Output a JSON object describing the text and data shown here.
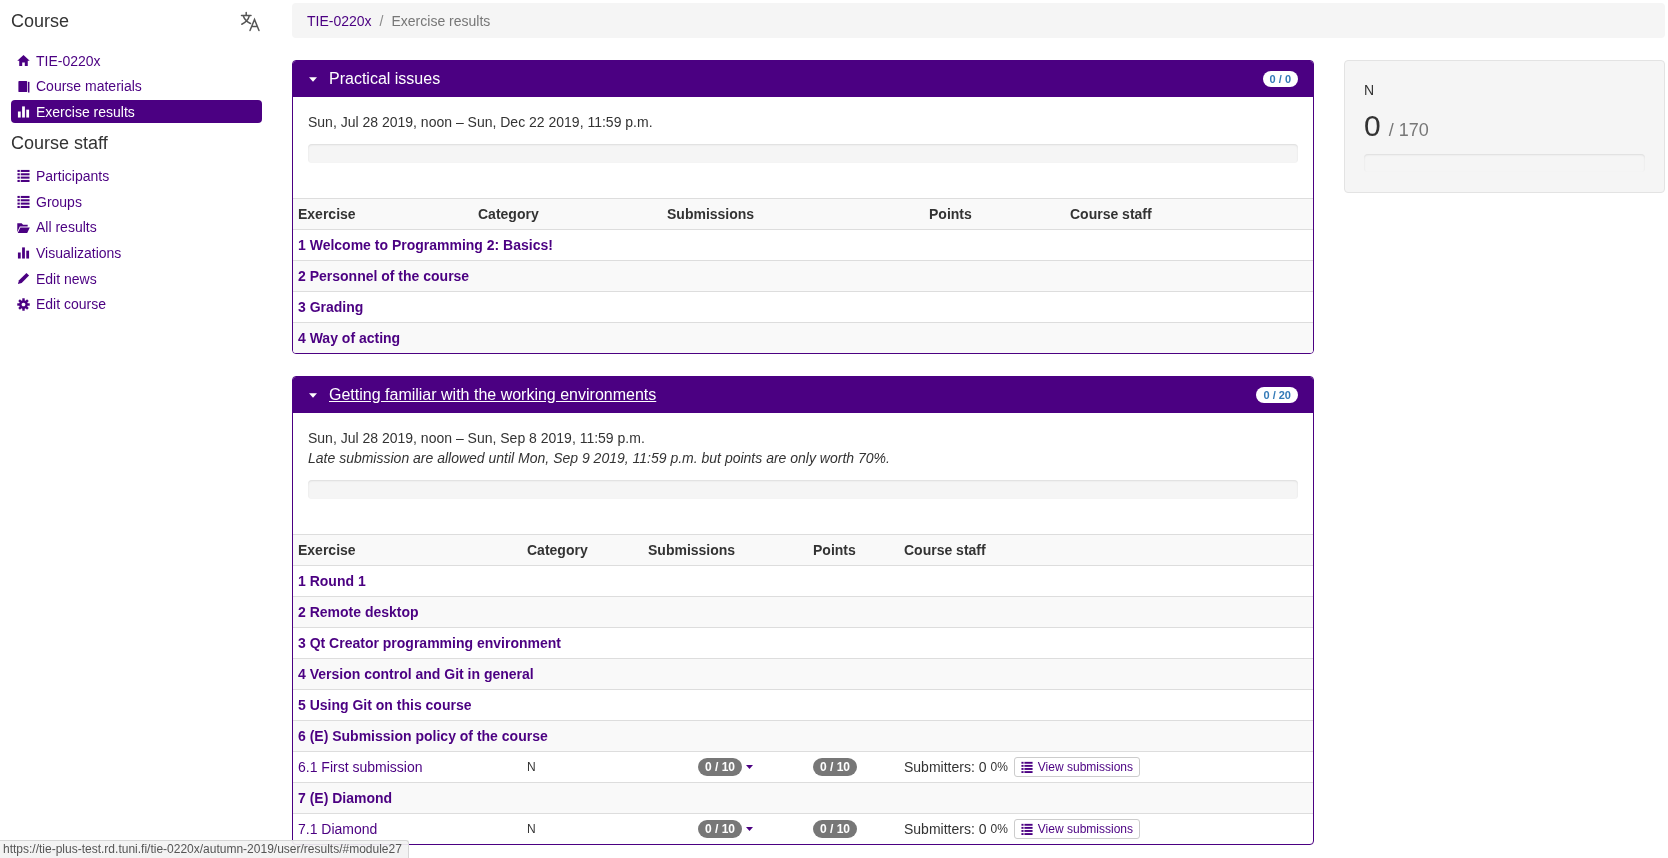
{
  "sidebar": {
    "sections": [
      {
        "title": "Course",
        "items": [
          {
            "kind": "home",
            "label": "TIE-0220x",
            "selected": false
          },
          {
            "kind": "book",
            "label": "Course materials",
            "selected": false
          },
          {
            "kind": "bar-chart",
            "label": "Exercise results",
            "selected": true
          }
        ]
      },
      {
        "title": "Course staff",
        "items": [
          {
            "kind": "list",
            "label": "Participants",
            "selected": false
          },
          {
            "kind": "list",
            "label": "Groups",
            "selected": false
          },
          {
            "kind": "folder",
            "label": "All results",
            "selected": false
          },
          {
            "kind": "bar-chart",
            "label": "Visualizations",
            "selected": false
          },
          {
            "kind": "pencil",
            "label": "Edit news",
            "selected": false
          },
          {
            "kind": "gear",
            "label": "Edit course",
            "selected": false
          }
        ]
      }
    ]
  },
  "breadcrumb": {
    "separator": "/",
    "items": [
      {
        "label": "TIE-0220x",
        "current": false
      },
      {
        "label": "Exercise results",
        "current": true
      }
    ]
  },
  "modules": [
    {
      "title": "Practical issues",
      "expanded": true,
      "hovered": false,
      "points": "0 / 0",
      "schedule": "Sun, Jul 28 2019, noon – Sun, Dec 22 2019, 11:59 p.m.",
      "table": {
        "columns": [
          "Exercise",
          "Category",
          "Submissions",
          "Points",
          "Course staff"
        ],
        "rows": [
          {
            "kind": "chapter",
            "title": "1 Welcome to Programming 2: Basics!"
          },
          {
            "kind": "chapter",
            "title": "2 Personnel of the course"
          },
          {
            "kind": "chapter",
            "title": "3 Grading"
          },
          {
            "kind": "chapter",
            "title": "4 Way of acting"
          }
        ]
      }
    },
    {
      "title": "Getting familiar with the working environments",
      "expanded": true,
      "hovered": true,
      "points": "0 / 20",
      "schedule": "Sun, Jul 28 2019, noon – Sun, Sep 8 2019, 11:59 p.m.",
      "late_note": "Late submission are allowed until Mon, Sep 9 2019, 11:59 p.m. but points are only worth 70%.",
      "table": {
        "columns": [
          "Exercise",
          "Category",
          "Submissions",
          "Points",
          "Course staff"
        ],
        "rows": [
          {
            "kind": "chapter",
            "title": "1 Round 1"
          },
          {
            "kind": "chapter",
            "title": "2 Remote desktop"
          },
          {
            "kind": "chapter",
            "title": "3 Qt Creator programming environment"
          },
          {
            "kind": "chapter",
            "title": "4 Version control and Git in general"
          },
          {
            "kind": "chapter",
            "title": "5 Using Git on this course"
          },
          {
            "kind": "chapter",
            "title": "6 (E) Submission policy of the course"
          },
          {
            "kind": "exercise",
            "title": "6.1 First submission",
            "category": "N",
            "submissions": "0 / 10",
            "points": "0 / 10",
            "submitters": "Submitters: 0",
            "percent": "0%",
            "button": "View submissions"
          },
          {
            "kind": "chapter",
            "title": "7 (E) Diamond"
          },
          {
            "kind": "exercise",
            "title": "7.1 Diamond",
            "category": "N",
            "submissions": "0 / 10",
            "points": "0 / 10",
            "submitters": "Submitters: 0",
            "percent": "0%",
            "button": "View submissions"
          }
        ]
      }
    }
  ],
  "summary": {
    "category": "N",
    "points": "0",
    "max": "/ 170"
  },
  "status_url": "https://tie-plus-test.rd.tuni.fi/tie-0220x/autumn-2019/user/results/#module27"
}
